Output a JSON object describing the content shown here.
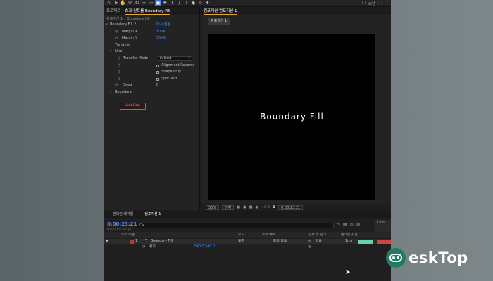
{
  "toolbar": {
    "tools": [
      "home-icon",
      "select-tool-icon",
      "hand-tool-icon",
      "zoom-tool-icon",
      "rotate-tool-icon",
      "camera-tool-icon",
      "pan-behind-tool-icon",
      "mask-tool-icon",
      "pen-tool-icon",
      "type-tool-icon",
      "brush-tool-icon",
      "clone-stamp-icon",
      "eraser-tool-icon",
      "roto-brush-icon",
      "puppet-pin-icon"
    ],
    "right_labels": [
      "□",
      "스냅",
      "⬚",
      "⬚"
    ]
  },
  "effect_controls": {
    "tabs": [
      "프로젝트",
      "효과 컨트롤 Boundary Fill"
    ],
    "subtitle": "컴포지션 1 • Boundary Fill",
    "rows": [
      {
        "label": "Boundary Fill 2",
        "value": "다시 설정"
      },
      {
        "label": "Margin X",
        "value": "50.00"
      },
      {
        "label": "Margin Y",
        "value": "50.00"
      },
      {
        "label": "Tie style",
        "value": ""
      },
      {
        "label": "Line",
        "value": ""
      },
      {
        "label": "Transfer Mode",
        "value": "In front"
      },
      {
        "label": "Alignment Reverse",
        "value": ""
      },
      {
        "label": "Shape only",
        "value": ""
      },
      {
        "label": "Split Text",
        "value": ""
      },
      {
        "label": "Seed",
        "value": "0"
      },
      {
        "label": "Boundary",
        "value": ""
      }
    ],
    "reset_button": "Visit Beta"
  },
  "viewer": {
    "panel_tab": "컴포지션 컴포지션 1",
    "comp_tab": "컴포지션 1",
    "canvas_text": "Boundary Fill",
    "zoom": "50%",
    "resolution": "전체",
    "exposure": "+0.0",
    "timecode": "0:00:23:21"
  },
  "timeline": {
    "tabs": [
      "렌더링 대기열",
      "컴포지션 1"
    ],
    "timecode": "0:00:23:21",
    "fps": "00571 (25.00 fps)",
    "search_placeholder": "Ω▾",
    "ruler_label": "1:00s",
    "columns": [
      "소스 이름",
      "모드",
      "트랙 매트",
      "상위 및 링크",
      "렌더링 시간"
    ],
    "layer": {
      "index": "1",
      "type_icon": "T",
      "name": "Boundary Fill",
      "mode": "표준",
      "matte": "매트 없음",
      "parent": "없음",
      "render_time": "1ms"
    },
    "subrow": {
      "label": "위치",
      "value": "540.0,540.0"
    }
  },
  "watermark": {
    "text": "eskTop"
  },
  "colors": {
    "accent_blue": "#4f8ef0",
    "render_green": "#6ad3a6",
    "layer_red": "#b83a3a",
    "watermark_green": "#1f7d63"
  }
}
